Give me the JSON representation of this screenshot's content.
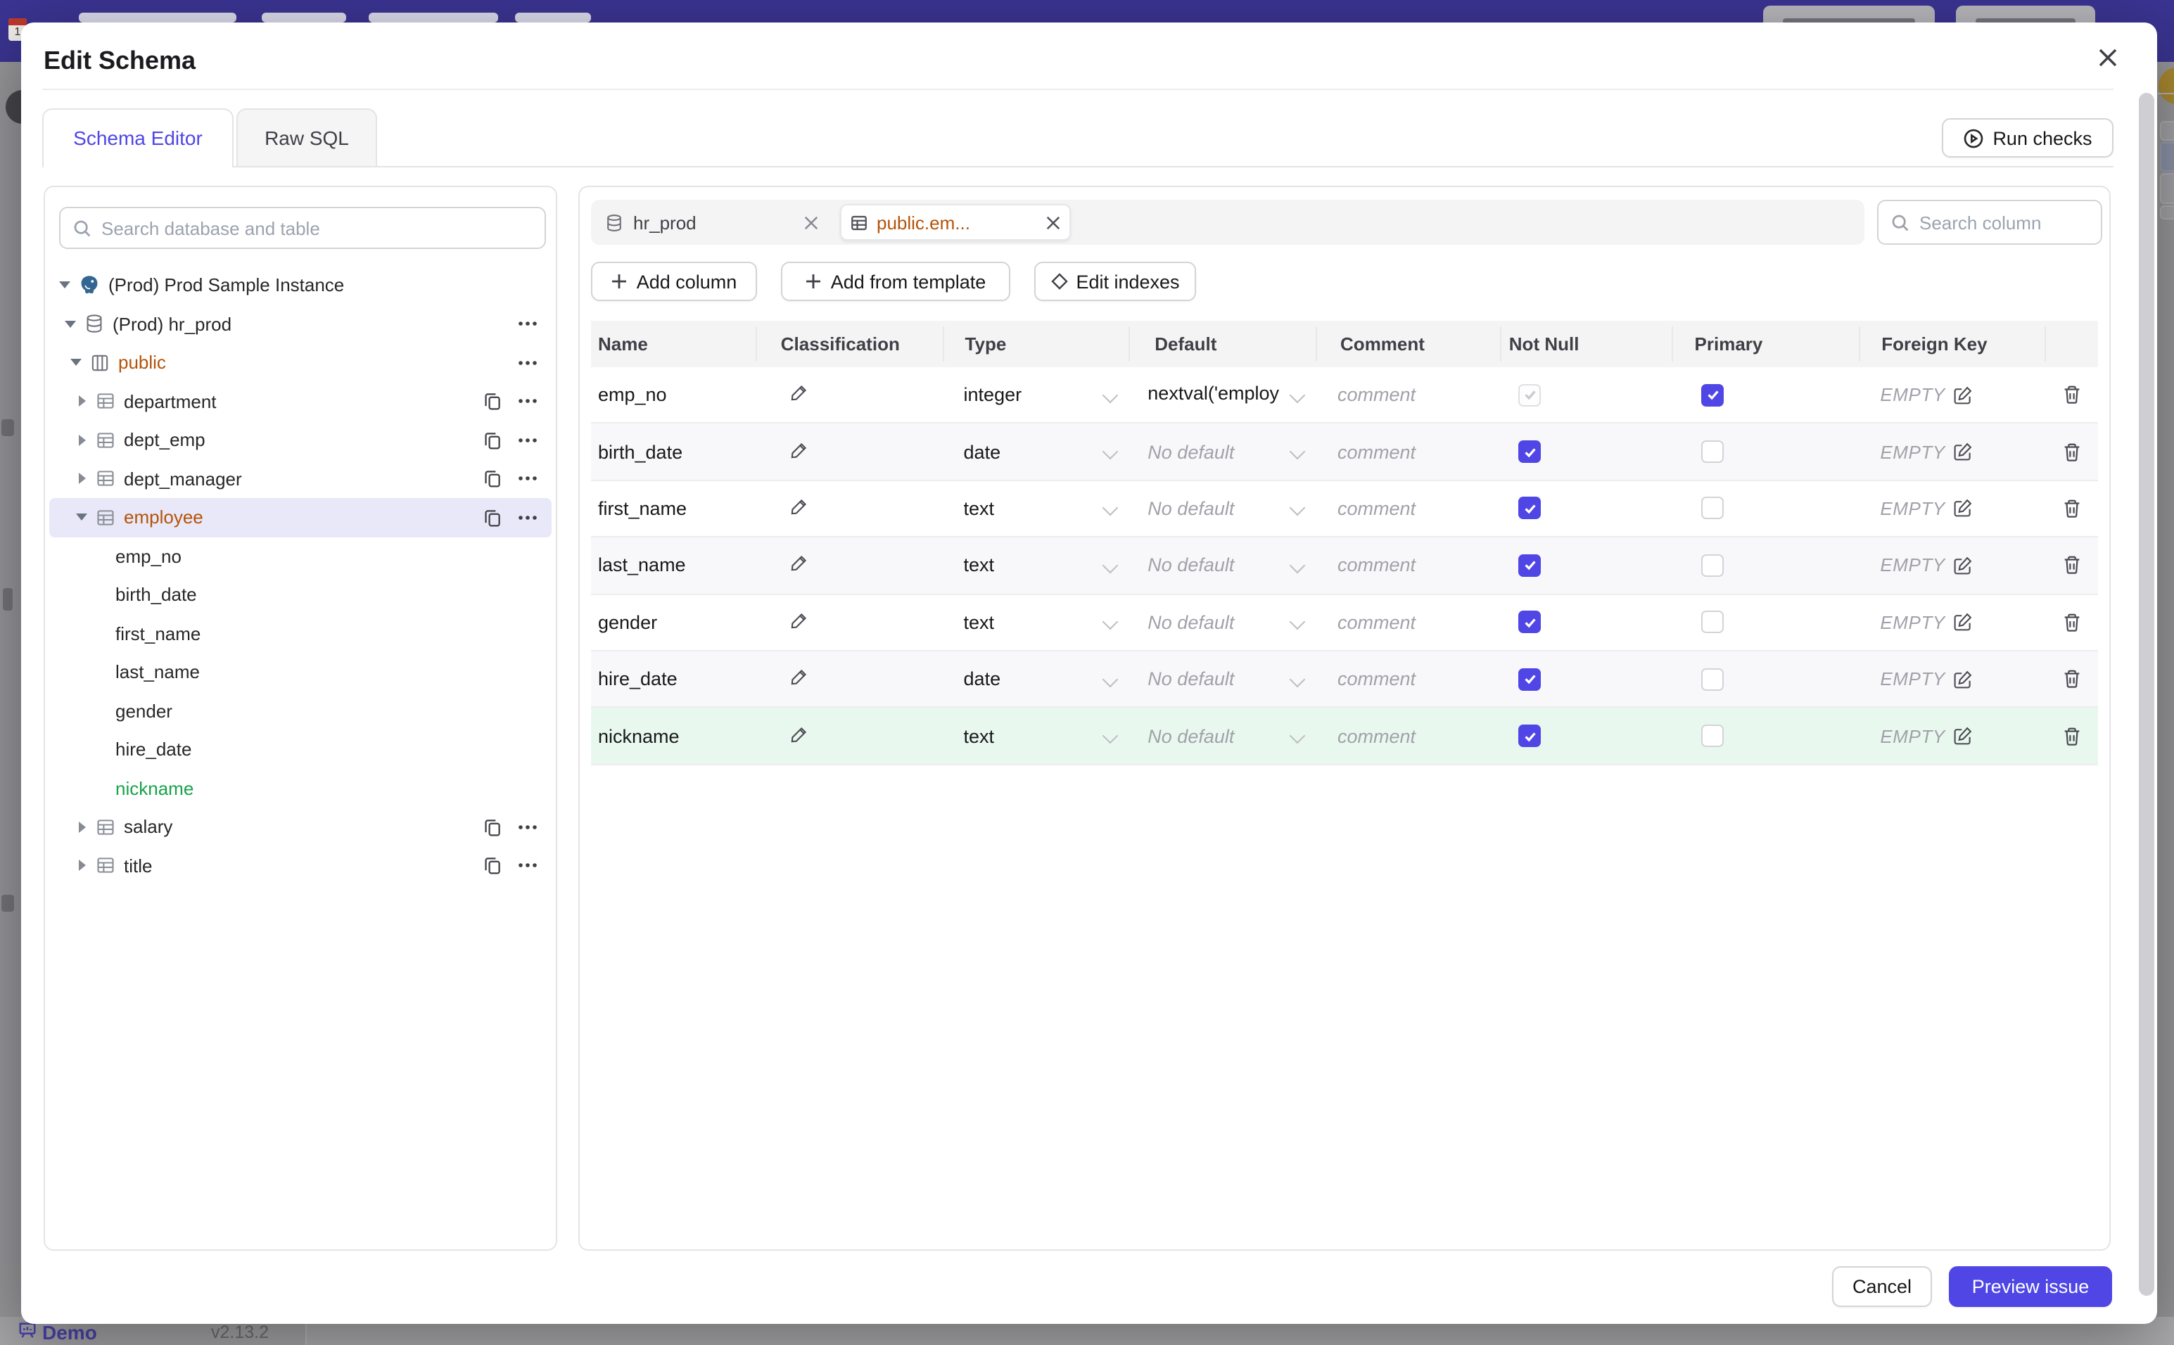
{
  "dialog": {
    "title": "Edit Schema",
    "tabs": [
      {
        "label": "Schema Editor",
        "active": true
      },
      {
        "label": "Raw SQL",
        "active": false
      }
    ],
    "run_checks_label": "Run checks",
    "cancel_label": "Cancel",
    "submit_label": "Preview issue"
  },
  "sidebar": {
    "search_placeholder": "Search database and table",
    "tree": [
      {
        "label": "(Prod) Prod Sample Instance",
        "type": "instance",
        "expanded": true
      },
      {
        "label": "(Prod) hr_prod",
        "type": "database",
        "expanded": true,
        "more": true
      },
      {
        "label": "public",
        "type": "schema",
        "expanded": true,
        "more": true,
        "amber": true
      },
      {
        "label": "department",
        "type": "table",
        "copy": true,
        "more": true
      },
      {
        "label": "dept_emp",
        "type": "table",
        "copy": true,
        "more": true
      },
      {
        "label": "dept_manager",
        "type": "table",
        "copy": true,
        "more": true
      },
      {
        "label": "employee",
        "type": "table",
        "expanded": true,
        "selected": true,
        "amber": true,
        "copy": true,
        "more": true
      },
      {
        "label": "emp_no",
        "type": "column"
      },
      {
        "label": "birth_date",
        "type": "column"
      },
      {
        "label": "first_name",
        "type": "column"
      },
      {
        "label": "last_name",
        "type": "column"
      },
      {
        "label": "gender",
        "type": "column"
      },
      {
        "label": "hire_date",
        "type": "column"
      },
      {
        "label": "nickname",
        "type": "column",
        "green": true
      },
      {
        "label": "salary",
        "type": "table",
        "copy": true,
        "more": true
      },
      {
        "label": "title",
        "type": "table",
        "copy": true,
        "more": true
      }
    ]
  },
  "editor": {
    "chips": [
      {
        "label": "hr_prod",
        "kind": "database"
      },
      {
        "label": "public.em...",
        "kind": "table",
        "active": true
      }
    ],
    "column_search_placeholder": "Search column",
    "toolbar": {
      "add_column": "Add column",
      "add_from_template": "Add from template",
      "edit_indexes": "Edit indexes"
    },
    "table": {
      "headers": [
        "Name",
        "Classification",
        "Type",
        "Default",
        "Comment",
        "Not Null",
        "Primary",
        "Foreign Key"
      ],
      "comment_placeholder": "comment",
      "foreign_key_empty": "EMPTY",
      "no_default": "No default",
      "rows": [
        {
          "name": "emp_no",
          "type": "integer",
          "default": "nextval('employ",
          "has_default": true,
          "not_null": true,
          "not_null_disabled": true,
          "primary": true,
          "foreign_key": "EMPTY",
          "is_new": false
        },
        {
          "name": "birth_date",
          "type": "date",
          "default": "No default",
          "has_default": false,
          "not_null": true,
          "primary": false,
          "foreign_key": "EMPTY",
          "is_new": false
        },
        {
          "name": "first_name",
          "type": "text",
          "default": "No default",
          "has_default": false,
          "not_null": true,
          "primary": false,
          "foreign_key": "EMPTY",
          "is_new": false
        },
        {
          "name": "last_name",
          "type": "text",
          "default": "No default",
          "has_default": false,
          "not_null": true,
          "primary": false,
          "foreign_key": "EMPTY",
          "is_new": false
        },
        {
          "name": "gender",
          "type": "text",
          "default": "No default",
          "has_default": false,
          "not_null": true,
          "primary": false,
          "foreign_key": "EMPTY",
          "is_new": false
        },
        {
          "name": "hire_date",
          "type": "date",
          "default": "No default",
          "has_default": false,
          "not_null": true,
          "primary": false,
          "foreign_key": "EMPTY",
          "is_new": false
        },
        {
          "name": "nickname",
          "type": "text",
          "default": "No default",
          "has_default": false,
          "not_null": true,
          "primary": false,
          "foreign_key": "EMPTY",
          "is_new": true
        }
      ]
    }
  },
  "statusbar": {
    "demo_label": "Demo",
    "version": "v2.13.2"
  },
  "colors": {
    "accent": "#4f46e5",
    "amber": "#b45309",
    "green": "#16a34a",
    "new_row_bg": "#e9f8ef",
    "header_purple": "#3b3492",
    "postgres_blue": "#336791"
  }
}
